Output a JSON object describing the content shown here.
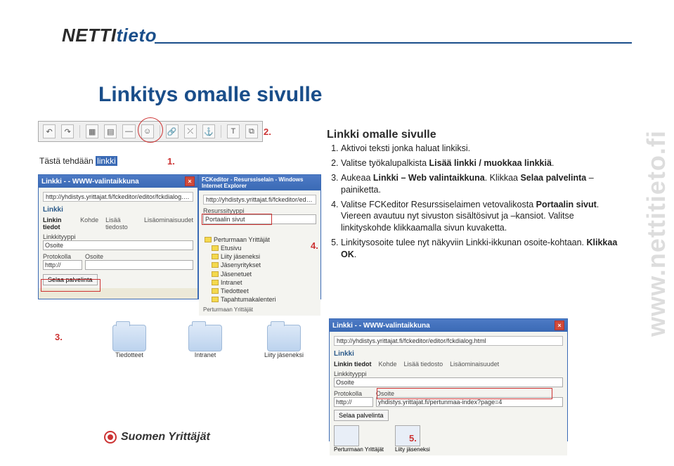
{
  "page_title": "Linkitys omalle sivulle",
  "logo": {
    "part1": "NETTI",
    "part2": "tieto"
  },
  "side_watermark": "www.nettitieto.fi",
  "step_heading": "Linkki omalle sivulle",
  "steps": [
    {
      "text_a": "Aktivoi teksti jonka haluat linkiksi."
    },
    {
      "text_a": "Valitse työkalupalkista ",
      "em": "Lisää linkki / muokkaa linkkiä",
      "text_b": "."
    },
    {
      "text_a": "Aukeaa ",
      "em": "Linkki – Web valintaikkuna",
      "text_b": ". Klikkaa ",
      "em2": "Selaa palvelinta",
      "text_c": " –painiketta."
    },
    {
      "text_a": "Valitse FCKeditor Resurssiselaimen vetovalikosta ",
      "em": "Portaalin sivut",
      "text_b": ". Viereen avautuu nyt sivuston sisältösivut ja –kansiot. Valitse linkityskohde klikkaamalla sivun kuvaketta."
    },
    {
      "text_a": "Linkitysosoite tulee nyt näkyviin Linkki-ikkunan osoite-kohtaan. ",
      "em": "Klikkaa OK",
      "text_b": "."
    }
  ],
  "toolbar_label": "2.",
  "markers": {
    "m1": "1.",
    "m2": "2.",
    "m3": "3.",
    "m4": "4.",
    "m5": "5."
  },
  "m1_text": {
    "prefix": "Tästä tehdään ",
    "link": "linkki"
  },
  "win1": {
    "title": "Linkki - - WWW-valintaikkuna",
    "address": "http://yhdistys.yrittajat.fi/fckeditor/editor/fckdialog.html",
    "panel": "Linkki",
    "tabs": [
      "Linkin tiedot",
      "Kohde",
      "Lisää tiedosto",
      "Lisäominaisuudet"
    ],
    "lbl_type": "Linkkityyppi",
    "val_type": "Osoite",
    "lbl_proto": "Protokolla",
    "val_proto": "http://",
    "lbl_addr": "Osoite",
    "btn_browse": "Selaa palvelinta"
  },
  "win2": {
    "title": "FCKeditor - Resurssiselain - Windows Internet Explorer",
    "address": "http://yhdistys.yrittajat.fi/fckeditor/editor/rtg/filemanager/browser/msquik/browser",
    "lbl_restype": "Resurssityyppi",
    "val_restype": "Portaalin sivut",
    "tree": [
      "Perturmaan Yrittäjät",
      "Etusivu",
      "Liity jäseneksi",
      "Jäsenyritykset",
      "Jäsenetuet",
      "Intranet",
      "Tiedotteet",
      "Tapahtumakalenteri"
    ],
    "bottom_lbl": "Perturmaan Yrittäjät"
  },
  "folders": [
    "Tiedotteet",
    "Intranet",
    "Liity jäseneksi"
  ],
  "win3": {
    "title": "Linkki - - WWW-valintaikkuna",
    "address": "http://yhdistys.yrittajat.fi/fckeditor/editor/fckdialog.html",
    "panel": "Linkki",
    "tabs": [
      "Linkin tiedot",
      "Kohde",
      "Lisää tiedosto",
      "Lisäominaisuudet"
    ],
    "lbl_type": "Linkkityyppi",
    "val_type": "Osoite",
    "lbl_proto": "Protokolla",
    "val_proto": "http://",
    "lbl_addr": "Osoite",
    "val_addr": "yhdistys.yrittajat.fi/pertunmaa-index?page=4",
    "btn_browse": "Selaa palvelinta",
    "mini_labels": [
      "Perturmaan Yrittäjät",
      "Liity jäseneksi"
    ]
  },
  "footer_logo": "Suomen Yrittäjät"
}
